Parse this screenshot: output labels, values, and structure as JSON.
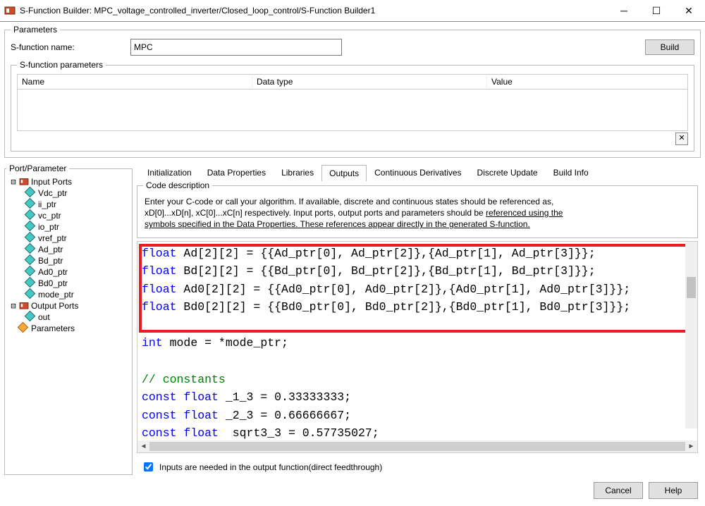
{
  "window": {
    "title": "S-Function Builder: MPC_voltage_controlled_inverter/Closed_loop_control/S-Function Builder1"
  },
  "parameters": {
    "legend": "Parameters",
    "name_label": "S-function name:",
    "name_value": "MPC",
    "build_label": "Build",
    "sub_legend": "S-function parameters",
    "th_name": "Name",
    "th_type": "Data type",
    "th_value": "Value"
  },
  "port_panel": {
    "legend": "Port/Parameter",
    "input_ports_label": "Input Ports",
    "output_ports_label": "Output Ports",
    "parameters_label": "Parameters",
    "input_ports": [
      "Vdc_ptr",
      "ii_ptr",
      "vc_ptr",
      "io_ptr",
      "vref_ptr",
      "Ad_ptr",
      "Bd_ptr",
      "Ad0_ptr",
      "Bd0_ptr",
      "mode_ptr"
    ],
    "output_ports": [
      "out"
    ]
  },
  "tabs": {
    "items": [
      "Initialization",
      "Data Properties",
      "Libraries",
      "Outputs",
      "Continuous Derivatives",
      "Discrete Update",
      "Build Info"
    ],
    "active_index": 3
  },
  "code_desc": {
    "legend": "Code description",
    "line1": "Enter your C-code or call your algorithm. If available, discrete and continuous states should be referenced as,",
    "line2_a": "xD[0]...xD[n], xC[0]...xC[n] respectively. Input ports, output ports and parameters should be ",
    "line2_b": "referenced using the",
    "line3_a": "symbols specified in the Data Properties. ",
    "line3_b": "These references appear directly in the generated S-function."
  },
  "code": {
    "l1a": "float",
    "l1b": " Ad[2][2] = {{Ad_ptr[0], Ad_ptr[2]},{Ad_ptr[1], Ad_ptr[3]}};",
    "l2a": "float",
    "l2b": " Bd[2][2] = {{Bd_ptr[0], Bd_ptr[2]},{Bd_ptr[1], Bd_ptr[3]}};",
    "l3a": "float",
    "l3b": " Ad0[2][2] = {{Ad0_ptr[0], Ad0_ptr[2]},{Ad0_ptr[1], Ad0_ptr[3]}};",
    "l4a": "float",
    "l4b": " Bd0[2][2] = {{Bd0_ptr[0], Bd0_ptr[2]},{Bd0_ptr[1], Bd0_ptr[3]}};",
    "l6a": "int",
    "l6b": " mode = *mode_ptr;",
    "l8": "// constants",
    "l9a": "const",
    "l9b": "float",
    "l9c": " _1_3 = 0.33333333;",
    "l10a": "const",
    "l10b": "float",
    "l10c": " _2_3 = 0.66666667;",
    "l11a": "const",
    "l11b": "float",
    "l11c": "  sqrt3_3 = 0.57735027;"
  },
  "checkbox": {
    "label": "Inputs are needed in the output function(direct feedthrough)"
  },
  "buttons": {
    "cancel": "Cancel",
    "help": "Help"
  }
}
